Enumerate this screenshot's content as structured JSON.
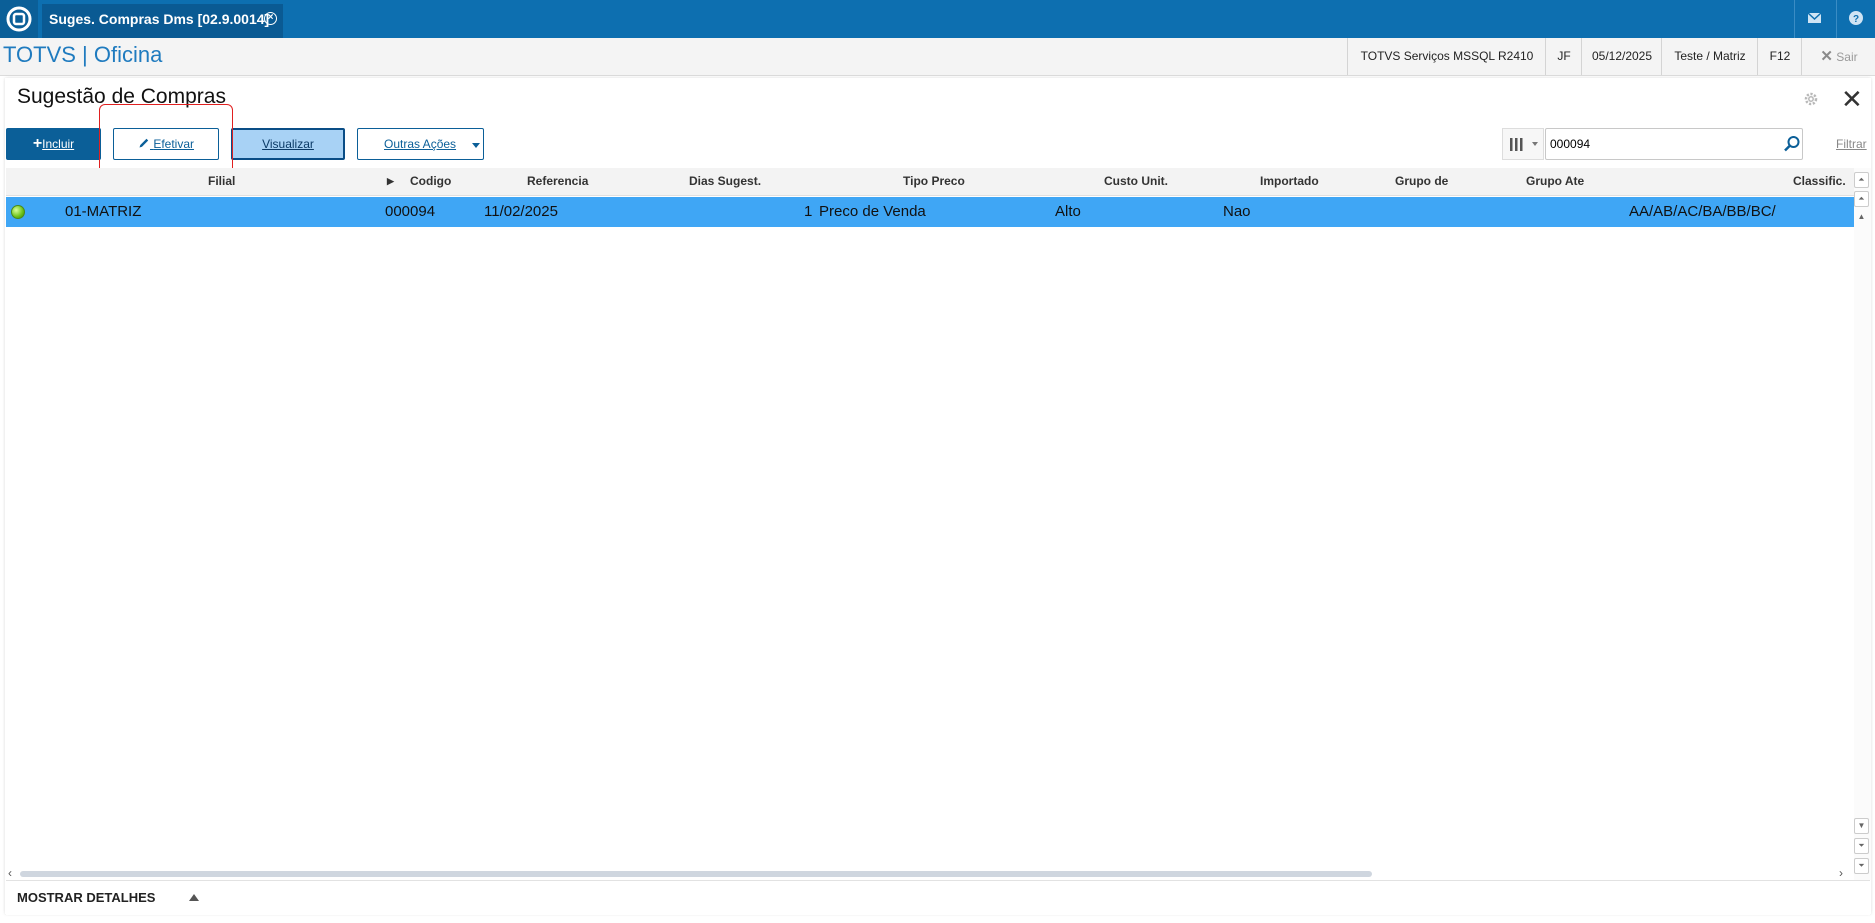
{
  "app": {
    "tab_title": "Suges. Compras Dms [02.9.0014]",
    "brand": "TOTVS | Oficina"
  },
  "header_info": {
    "server": "TOTVS Serviços MSSQL R2410",
    "user": "JF",
    "date": "05/12/2025",
    "environment": "Teste / Matriz",
    "shortcut": "F12",
    "exit_label": "Sair"
  },
  "page": {
    "title": "Sugestão de Compras"
  },
  "toolbar": {
    "incluir_label": "Incluir",
    "efetivar_label": "Efetivar",
    "visualizar_label": "Visualizar",
    "outras_label": "Outras Ações"
  },
  "search": {
    "value": "000094",
    "filter_label": "Filtrar"
  },
  "grid": {
    "columns": {
      "filial": "Filial",
      "codigo": "Codigo",
      "referencia": "Referencia",
      "dias": "Dias Sugest.",
      "tipo_preco": "Tipo Preco",
      "custo": "Custo Unit.",
      "importado": "Importado",
      "grupo_de": "Grupo de",
      "grupo_ate": "Grupo Ate",
      "classific": "Classific."
    },
    "rows": [
      {
        "filial": "01-MATRIZ",
        "codigo": "000094",
        "referencia": "11/02/2025",
        "dias": "1",
        "tipo_preco": "Preco de Venda",
        "custo": "Alto",
        "importado": "Nao",
        "grupo_de": "",
        "grupo_ate": "",
        "classific": "AA/AB/AC/BA/BB/BC/"
      }
    ]
  },
  "footer": {
    "details_label": "MOSTRAR DETALHES"
  },
  "colors": {
    "topbar": "#0d6fb0",
    "primary": "#0b5f98",
    "row_selected": "#3fa6f5",
    "highlight": "#e02020"
  },
  "icons": [
    "totvs-logo-icon",
    "mail-icon",
    "help-icon",
    "close-icon",
    "pencil-icon",
    "plus-icon",
    "gear-icon",
    "columns-icon",
    "search-icon",
    "chevron-down-icon",
    "status-green-icon"
  ]
}
